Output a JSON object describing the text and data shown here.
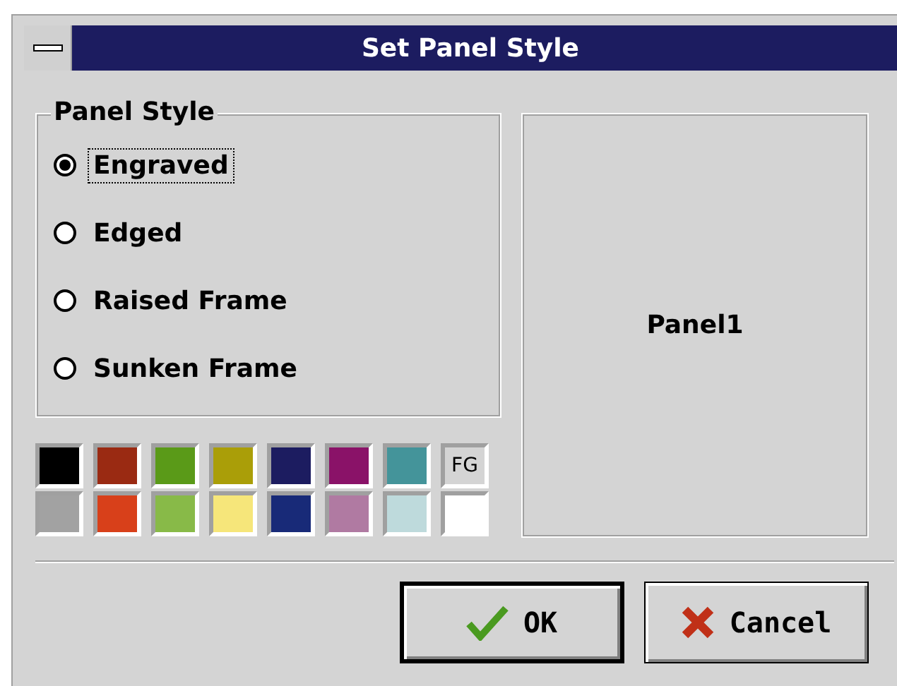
{
  "window": {
    "title": "Set Panel Style"
  },
  "panel_style": {
    "label": "Panel Style",
    "options": [
      {
        "label": "Engraved",
        "selected": true
      },
      {
        "label": "Edged",
        "selected": false
      },
      {
        "label": "Raised Frame",
        "selected": false
      },
      {
        "label": "Sunken Frame",
        "selected": false
      }
    ]
  },
  "palette": [
    {
      "kind": "color",
      "color": "#000000"
    },
    {
      "kind": "color",
      "color": "#9a2a12"
    },
    {
      "kind": "color",
      "color": "#5a9a18"
    },
    {
      "kind": "color",
      "color": "#aa9e08"
    },
    {
      "kind": "color",
      "color": "#1c1c60"
    },
    {
      "kind": "color",
      "color": "#8a1268"
    },
    {
      "kind": "color",
      "color": "#44949a"
    },
    {
      "kind": "label",
      "label": "FG"
    },
    {
      "kind": "color",
      "color": "#a2a2a2"
    },
    {
      "kind": "color",
      "color": "#d8401a"
    },
    {
      "kind": "color",
      "color": "#88ba48"
    },
    {
      "kind": "color",
      "color": "#f6e67a"
    },
    {
      "kind": "color",
      "color": "#182a78"
    },
    {
      "kind": "color",
      "color": "#b07aa2"
    },
    {
      "kind": "color",
      "color": "#bedadc"
    },
    {
      "kind": "color",
      "color": "#ffffff"
    }
  ],
  "preview": {
    "label": "Panel1"
  },
  "buttons": [
    {
      "kind": "ok",
      "label": "OK",
      "default": true
    },
    {
      "kind": "cancel",
      "label": "Cancel",
      "default": false
    }
  ]
}
